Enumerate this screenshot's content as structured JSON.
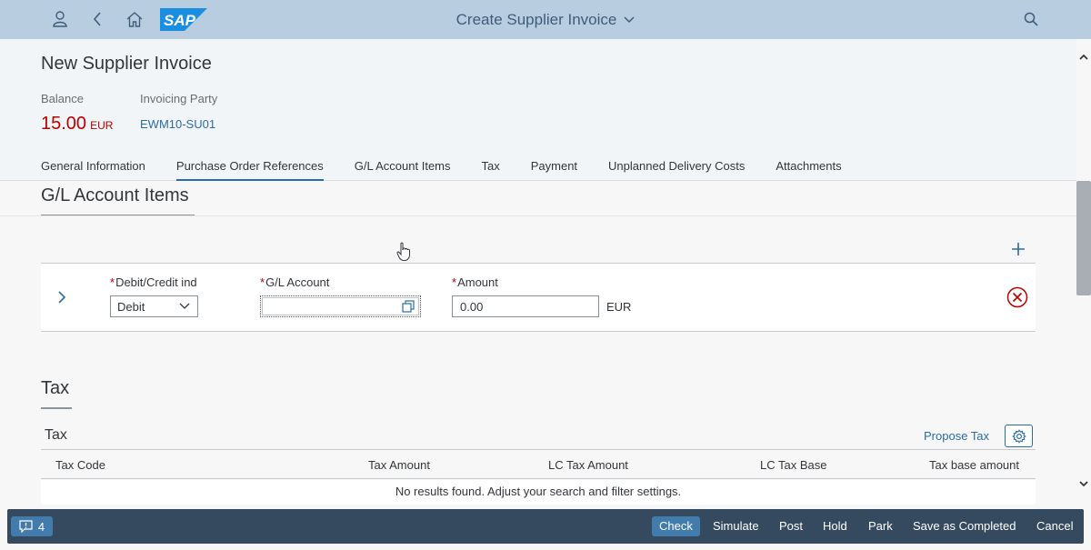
{
  "shell": {
    "title": "Create Supplier Invoice",
    "logo_text": "SAP"
  },
  "header": {
    "title": "New Supplier Invoice",
    "balance_label": "Balance",
    "balance_value": "15.00",
    "balance_currency": "EUR",
    "party_label": "Invoicing Party",
    "party_value": "EWM10-SU01"
  },
  "tabs": [
    {
      "label": "General Information"
    },
    {
      "label": "Purchase Order References"
    },
    {
      "label": "G/L Account Items"
    },
    {
      "label": "Tax"
    },
    {
      "label": "Payment"
    },
    {
      "label": "Unplanned Delivery Costs"
    },
    {
      "label": "Attachments"
    }
  ],
  "active_tab": "Purchase Order References",
  "gl_section": {
    "title": "G/L Account Items",
    "debit_credit_label": "Debit/Credit ind",
    "debit_credit_value": "Debit",
    "gl_account_label": "G/L Account",
    "gl_account_value": "",
    "amount_label": "Amount",
    "amount_value": "0.00",
    "amount_currency": "EUR"
  },
  "tax_section": {
    "title": "Tax",
    "table_title": "Tax",
    "propose_label": "Propose Tax",
    "columns": [
      "Tax Code",
      "Tax Amount",
      "LC Tax Amount",
      "LC Tax Base",
      "Tax base amount"
    ],
    "no_results": "No results found. Adjust your search and filter settings."
  },
  "footer": {
    "message_count": "4",
    "buttons": [
      "Check",
      "Simulate",
      "Post",
      "Hold",
      "Park",
      "Save as Completed",
      "Cancel"
    ]
  },
  "colors": {
    "shell": "#b9cde1",
    "accent": "#2a6cab",
    "negative": "#bb0000",
    "footer": "#354a5f",
    "emphasized": "#427cac"
  }
}
